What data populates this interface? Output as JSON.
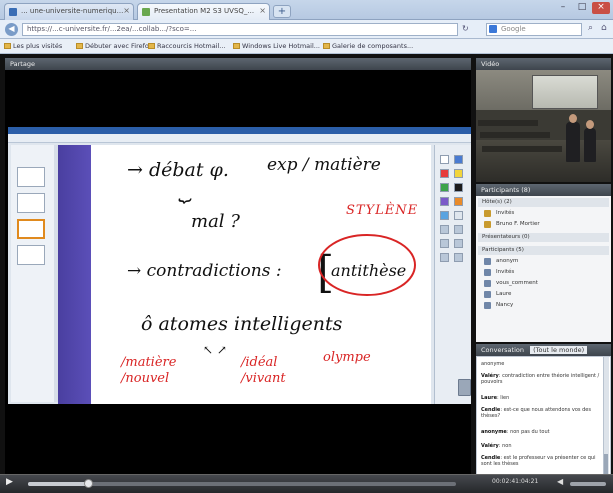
{
  "browser": {
    "tabs": [
      {
        "label": "... une-universite-numeriqu..."
      },
      {
        "label": "Presentation M2 S3 UVSQ_..."
      }
    ],
    "new_tab_label": "+",
    "url": "https://...c-universite.fr/...2ea/...collab.../?sco=...",
    "search_placeholder": "Google",
    "bookmarks": [
      "Les plus visités",
      "Débuter avec Firefox",
      "Raccourcis Hotmail...",
      "Windows Live Hotmail...",
      "Galerie de composants..."
    ]
  },
  "app": {
    "share_header": "Partage",
    "video_header": "Vidéo",
    "participants_header": "Participants (8)",
    "participants": {
      "hosts_label": "Hôte(s) (2)",
      "hosts": [
        "Invités",
        "Bruno F. Mortier"
      ],
      "presenters_label": "Présentateurs (0)",
      "attendees_label": "Participants (5)",
      "attendees": [
        "anonym",
        "Invités",
        "vous_comment",
        "Laure",
        "Nancy"
      ]
    },
    "conversation_header": "Conversation",
    "conversation_tab": "(Tout le monde)",
    "messages": [
      {
        "author": "",
        "text": "anonyme"
      },
      {
        "author": "Valéry",
        "text": "contradiction entre théorie intelligent / pouvoirs"
      },
      {
        "author": "Laure",
        "text": "lien"
      },
      {
        "author": "Cendie",
        "text": "est-ce que nous attendons vos des thèses?"
      },
      {
        "author": "anonyme",
        "text": "non pas du tout"
      },
      {
        "author": "Valéry",
        "text": "non"
      },
      {
        "author": "Cendie",
        "text": "est le professeur va présenter ce qui sont les thèses"
      }
    ]
  },
  "board": {
    "line1a": "→ débat φ.",
    "line1b": "exp / matière",
    "line2": "mal ?",
    "line3a": "→ contradictions :",
    "line3b": "antithèse",
    "stylene": "STYLÈNE",
    "line4": "ô atomes intelligents",
    "red1": "/matière /nouvel",
    "red2": "/idéal /vivant",
    "red3": "olympe"
  },
  "player": {
    "time": "00:02:41:04:21",
    "play_icon": "play-icon"
  },
  "colors": {
    "accent": "#2b5ea8",
    "ink_red": "#d92525",
    "app_bg": "#111111"
  }
}
